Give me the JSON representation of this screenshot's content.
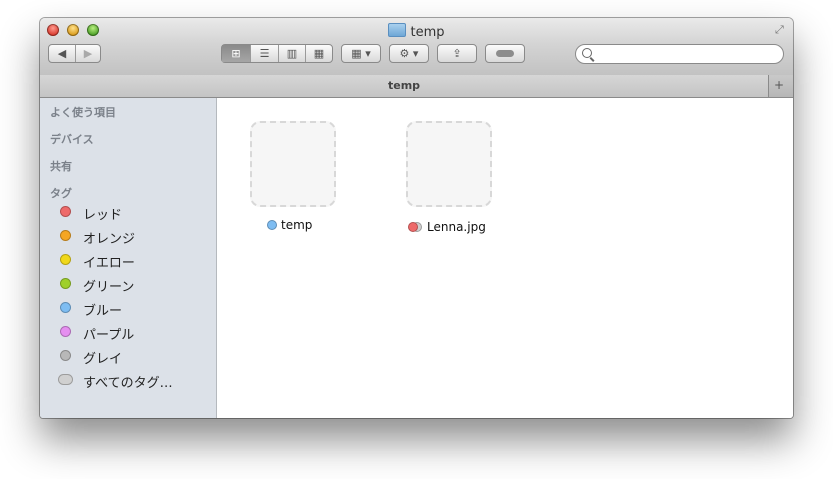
{
  "window": {
    "title": "temp",
    "title_icon": "folder-icon",
    "traffic_lights": {
      "close_color": "#e0443a",
      "minimize_color": "#e5a21f",
      "zoom_color": "#56b030"
    }
  },
  "toolbar": {
    "back_icon": "chevron-left-icon",
    "forward_icon": "chevron-right-icon",
    "view_modes": [
      "icon-view-icon",
      "list-view-icon",
      "column-view-icon",
      "coverflow-view-icon"
    ],
    "active_view": "icon-view-icon",
    "arrange_icon": "grid-arrange-icon",
    "action_icon": "gear-icon",
    "share_icon": "share-icon",
    "tags_icon": "tag-icon",
    "search_placeholder": ""
  },
  "tabbar": {
    "tab_label": "temp",
    "add_icon": "plus-icon"
  },
  "sidebar": {
    "sections": {
      "favorites": "よく使う項目",
      "devices": "デバイス",
      "shared": "共有",
      "tags": "タグ"
    },
    "tags": [
      {
        "label": "レッド",
        "color": "#ee6a6a"
      },
      {
        "label": "オレンジ",
        "color": "#f5a623"
      },
      {
        "label": "イエロー",
        "color": "#f0d81a"
      },
      {
        "label": "グリーン",
        "color": "#9fd02a"
      },
      {
        "label": "ブルー",
        "color": "#7ebdf2"
      },
      {
        "label": "パープル",
        "color": "#e58ff0"
      },
      {
        "label": "グレイ",
        "color": "#b8b8b8"
      },
      {
        "label": "すべてのタグ…",
        "color": "#d0d0d0"
      }
    ]
  },
  "files": [
    {
      "name": "temp",
      "tag_colors": [
        "#7ebdf2"
      ]
    },
    {
      "name": "Lenna.jpg",
      "tag_colors": [
        "#ee6a6a",
        "#d0d0d0"
      ]
    }
  ]
}
